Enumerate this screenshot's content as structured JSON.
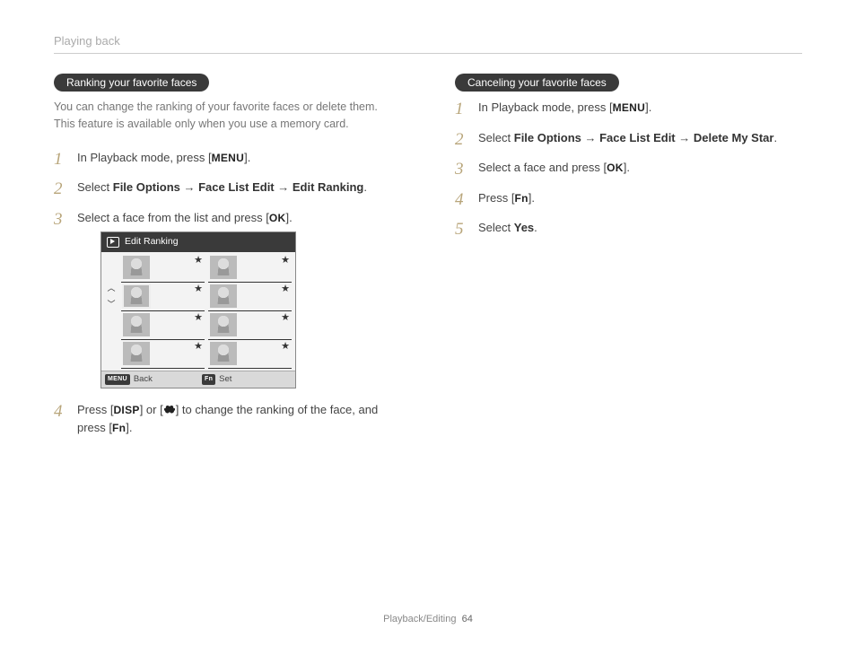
{
  "header": {
    "section": "Playing back"
  },
  "footer": {
    "chapter": "Playback/Editing",
    "page": "64"
  },
  "left": {
    "pill": "Ranking your favorite faces",
    "intro": "You can change the ranking of your favorite faces or delete them. This feature is available only when you use a memory card.",
    "step1_a": "In Playback mode, press [",
    "step1_btn": "MENU",
    "step1_b": "].",
    "step2_a": "Select ",
    "step2_b1": "File Options",
    "step2_arrow1": " → ",
    "step2_b2": "Face List Edit",
    "step2_arrow2": " → ",
    "step2_b3": "Edit Ranking",
    "step2_c": ".",
    "step3_a": "Select a face from the list and press [",
    "step3_btn": "OK",
    "step3_b": "].",
    "step4_a": "Press [",
    "step4_b1": "DISP",
    "step4_mid": "] or [",
    "step4_c": "] to change the ranking of the face, and press [",
    "step4_b2": "Fn",
    "step4_d": "].",
    "ui": {
      "title": "Edit Ranking",
      "back_key": "MENU",
      "back": "Back",
      "set_key": "Fn",
      "set": "Set"
    }
  },
  "right": {
    "pill": "Canceling your favorite faces",
    "step1_a": "In Playback mode, press [",
    "step1_btn": "MENU",
    "step1_b": "].",
    "step2_a": "Select ",
    "step2_b1": "File Options",
    "step2_arrow1": " → ",
    "step2_b2": "Face List Edit",
    "step2_arrow2": " → ",
    "step2_b3": "Delete My Star",
    "step2_c": ".",
    "step3_a": "Select a face and press [",
    "step3_btn": "OK",
    "step3_b": "].",
    "step4_a": "Press [",
    "step4_btn": "Fn",
    "step4_b": "].",
    "step5_a": "Select ",
    "step5_b": "Yes",
    "step5_c": "."
  }
}
